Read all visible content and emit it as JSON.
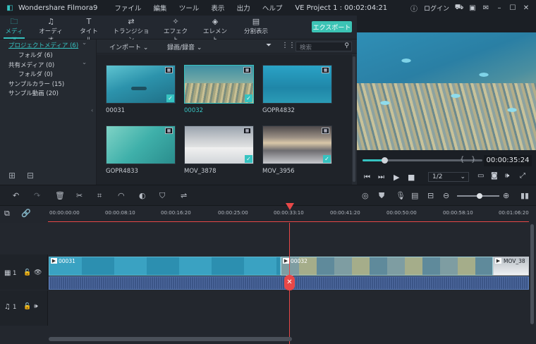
{
  "app": {
    "name": "Wondershare Filmora9",
    "project": "VE Project 1 : 00:02:04:21"
  },
  "menu": [
    "ファイル",
    "編集",
    "ツール",
    "表示",
    "出力",
    "ヘルプ"
  ],
  "titlebar_right": {
    "login": "ログイン"
  },
  "tabs": [
    {
      "label": "メディア",
      "icon": "folder-icon",
      "glyph": "🗀"
    },
    {
      "label": "オーディオ",
      "icon": "music-icon",
      "glyph": "♫"
    },
    {
      "label": "タイトル",
      "icon": "title-icon",
      "glyph": "T"
    },
    {
      "label": "トランジション",
      "icon": "transition-icon",
      "glyph": "⇄"
    },
    {
      "label": "エフェクト",
      "icon": "effect-icon",
      "glyph": "✧"
    },
    {
      "label": "エレメント",
      "icon": "element-icon",
      "glyph": "◈"
    },
    {
      "label": "分割表示",
      "icon": "split-icon",
      "glyph": "▤"
    }
  ],
  "export_label": "エクスポート",
  "tree": [
    {
      "label": "プロジェクトメディア (6)",
      "active": true
    },
    {
      "label": "フォルダ (6)"
    },
    {
      "label": "共有メディア (0)"
    },
    {
      "label": "フォルダ (0)"
    },
    {
      "label": "サンプルカラー (15)"
    },
    {
      "label": "サンプル動画 (20)"
    }
  ],
  "media_toolbar": {
    "import": "インポート",
    "record": "録画/録音",
    "search_placeholder": "検索"
  },
  "media": [
    {
      "name": "00031",
      "checked": true,
      "selected": false
    },
    {
      "name": "00032",
      "checked": true,
      "selected": true
    },
    {
      "name": "GOPR4832",
      "checked": false,
      "selected": false
    },
    {
      "name": "GOPR4833",
      "checked": false,
      "selected": false
    },
    {
      "name": "MOV_3878",
      "checked": true,
      "selected": false
    },
    {
      "name": "MOV_3956",
      "checked": true,
      "selected": false
    }
  ],
  "player": {
    "timecode": "00:00:35:24",
    "quality": "1/2",
    "progress": 0.18
  },
  "ruler": [
    "00:00:00:00",
    "00:00:08:10",
    "00:00:16:20",
    "00:00:25:00",
    "00:00:33:10",
    "00:00:41:20",
    "00:00:50:00",
    "00:00:58:10",
    "00:01:06:20"
  ],
  "tracks": {
    "video_label": "1",
    "audio_label": "1"
  },
  "clips": [
    {
      "name": "00031"
    },
    {
      "name": "00032"
    },
    {
      "name": "MOV_38"
    }
  ],
  "colors": {
    "accent": "#36c3c1",
    "playhead": "#e84848",
    "export": "#3cc4b5"
  }
}
